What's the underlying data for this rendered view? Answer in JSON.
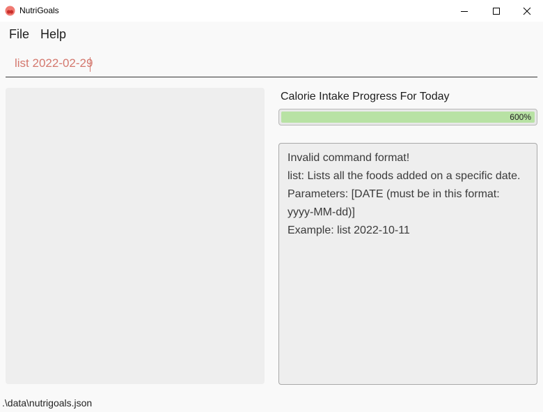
{
  "window": {
    "title": "NutriGoals",
    "controls": [
      "minimize",
      "maximize",
      "close"
    ]
  },
  "menu": {
    "items": [
      "File",
      "Help"
    ]
  },
  "command": {
    "value": "list 2022-02-29"
  },
  "progress": {
    "title": "Calorie Intake Progress For Today",
    "percent_label": "600%",
    "fraction": 6.0
  },
  "result": {
    "lines": [
      "Invalid command format!",
      "list: Lists all the foods added on a specific date.",
      "Parameters: [DATE (must be in this format:",
      "yyyy-MM-dd)]",
      "Example: list 2022-10-11"
    ]
  },
  "status": {
    "path": ".\\data\\nutrigoals.json"
  },
  "colors": {
    "command_text": "#d4786e",
    "progress_fill": "#b8e2a4",
    "app_icon": "#e8544e"
  }
}
